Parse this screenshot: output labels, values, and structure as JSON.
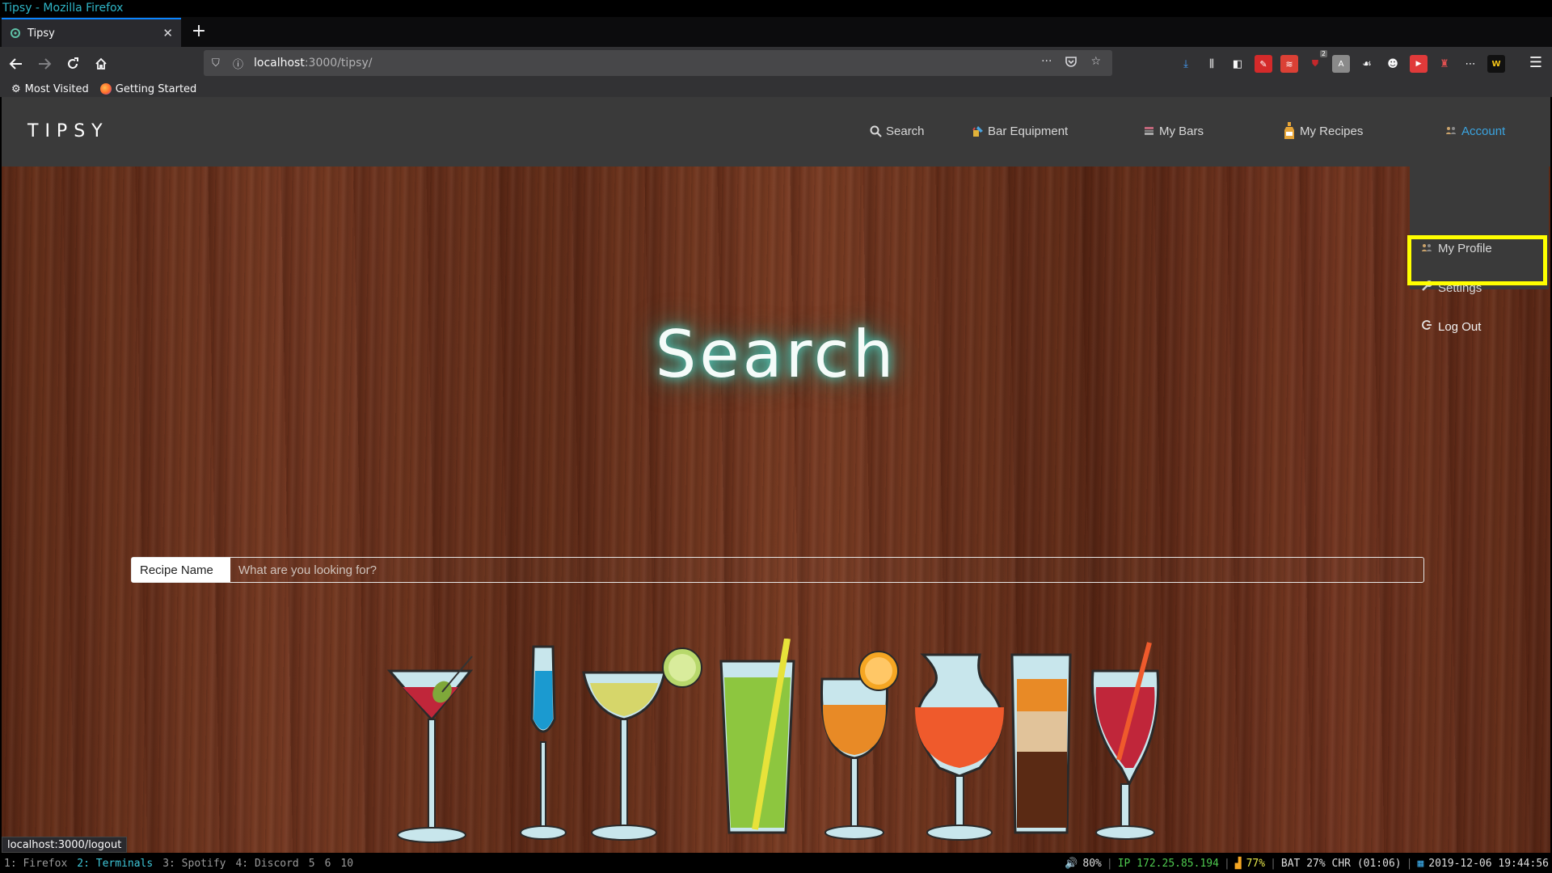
{
  "os": {
    "window_title": "Tipsy - Mozilla Firefox",
    "workspaces": [
      "1: Firefox",
      "2: Terminals",
      "3: Spotify",
      "4: Discord",
      "5",
      "6",
      "10"
    ],
    "active_workspace": "2: Terminals",
    "status": {
      "volume": "80%",
      "ip": "IP 172.25.85.194",
      "wifi": "77%",
      "battery": "BAT 27% CHR (01:06)",
      "datetime": "2019-12-06 19:44:56"
    }
  },
  "browser": {
    "tab_title": "Tipsy",
    "url_host": "localhost",
    "url_rest": ":3000/tipsy/",
    "bookmarks": [
      "Most Visited",
      "Getting Started"
    ],
    "status_url": "localhost:3000/logout",
    "badge_count": "2"
  },
  "site": {
    "brand": "TIPSY",
    "nav": {
      "search": "Search",
      "bar_equipment": "Bar Equipment",
      "my_bars": "My Bars",
      "my_recipes": "My Recipes",
      "account": "Account"
    },
    "account_menu": {
      "my_profile": "My Profile",
      "settings": "Settings",
      "log_out": "Log Out"
    },
    "hero_title": "Search",
    "search": {
      "label": "Recipe Name",
      "placeholder": "What are you looking for?",
      "value": ""
    }
  },
  "colors": {
    "accent_link": "#3aa4e0",
    "highlight": "#ffff00",
    "glow": "#53d3c3"
  }
}
